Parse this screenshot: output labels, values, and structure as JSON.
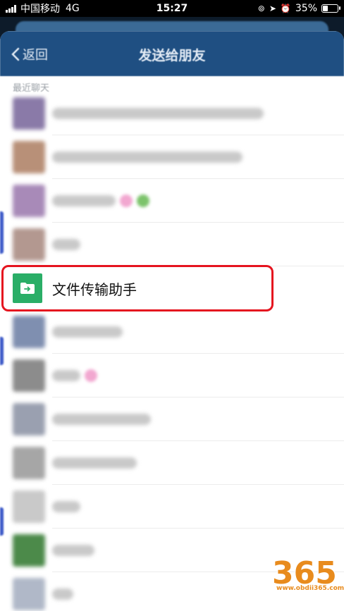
{
  "status_bar": {
    "carrier": "中国移动",
    "network": "4G",
    "time": "15:27",
    "battery_percent": "35%",
    "battery_level": 0.35
  },
  "nav": {
    "back_label": "返回",
    "title": "发送给朋友"
  },
  "section_title": "最近聊天",
  "highlighted_contact": {
    "name": "文件传输助手",
    "icon": "file-transfer-icon",
    "icon_color": "#2aae67"
  },
  "highlight_color": "#e5141f",
  "contacts_before": [
    {
      "avatar_color": "#8a7aa8",
      "name_width": 300,
      "emoji": []
    },
    {
      "avatar_color": "#b89078",
      "name_width": 270,
      "emoji": []
    },
    {
      "avatar_color": "#a88ab8",
      "name_width": 90,
      "emoji": [
        "#f2a7d0",
        "#7cc36b"
      ]
    },
    {
      "avatar_color": "#b39890",
      "name_width": 40,
      "emoji": []
    }
  ],
  "contacts_after": [
    {
      "avatar_color": "#7f8fb0",
      "name_width": 100,
      "emoji": []
    },
    {
      "avatar_color": "#8c8c8c",
      "name_width": 40,
      "emoji": [
        "#f2a7d0"
      ]
    },
    {
      "avatar_color": "#9aa0b0",
      "name_width": 140,
      "emoji": []
    },
    {
      "avatar_color": "#a6a6a6",
      "name_width": 120,
      "emoji": []
    },
    {
      "avatar_color": "#c9c9c9",
      "name_width": 40,
      "emoji": []
    },
    {
      "avatar_color": "#4c8a4a",
      "name_width": 60,
      "emoji": []
    },
    {
      "avatar_color": "#b0b8c8",
      "name_width": 30,
      "emoji": []
    }
  ],
  "watermark": {
    "number": "365",
    "url": "www.obdii365.com",
    "color": "#e88b1d"
  }
}
